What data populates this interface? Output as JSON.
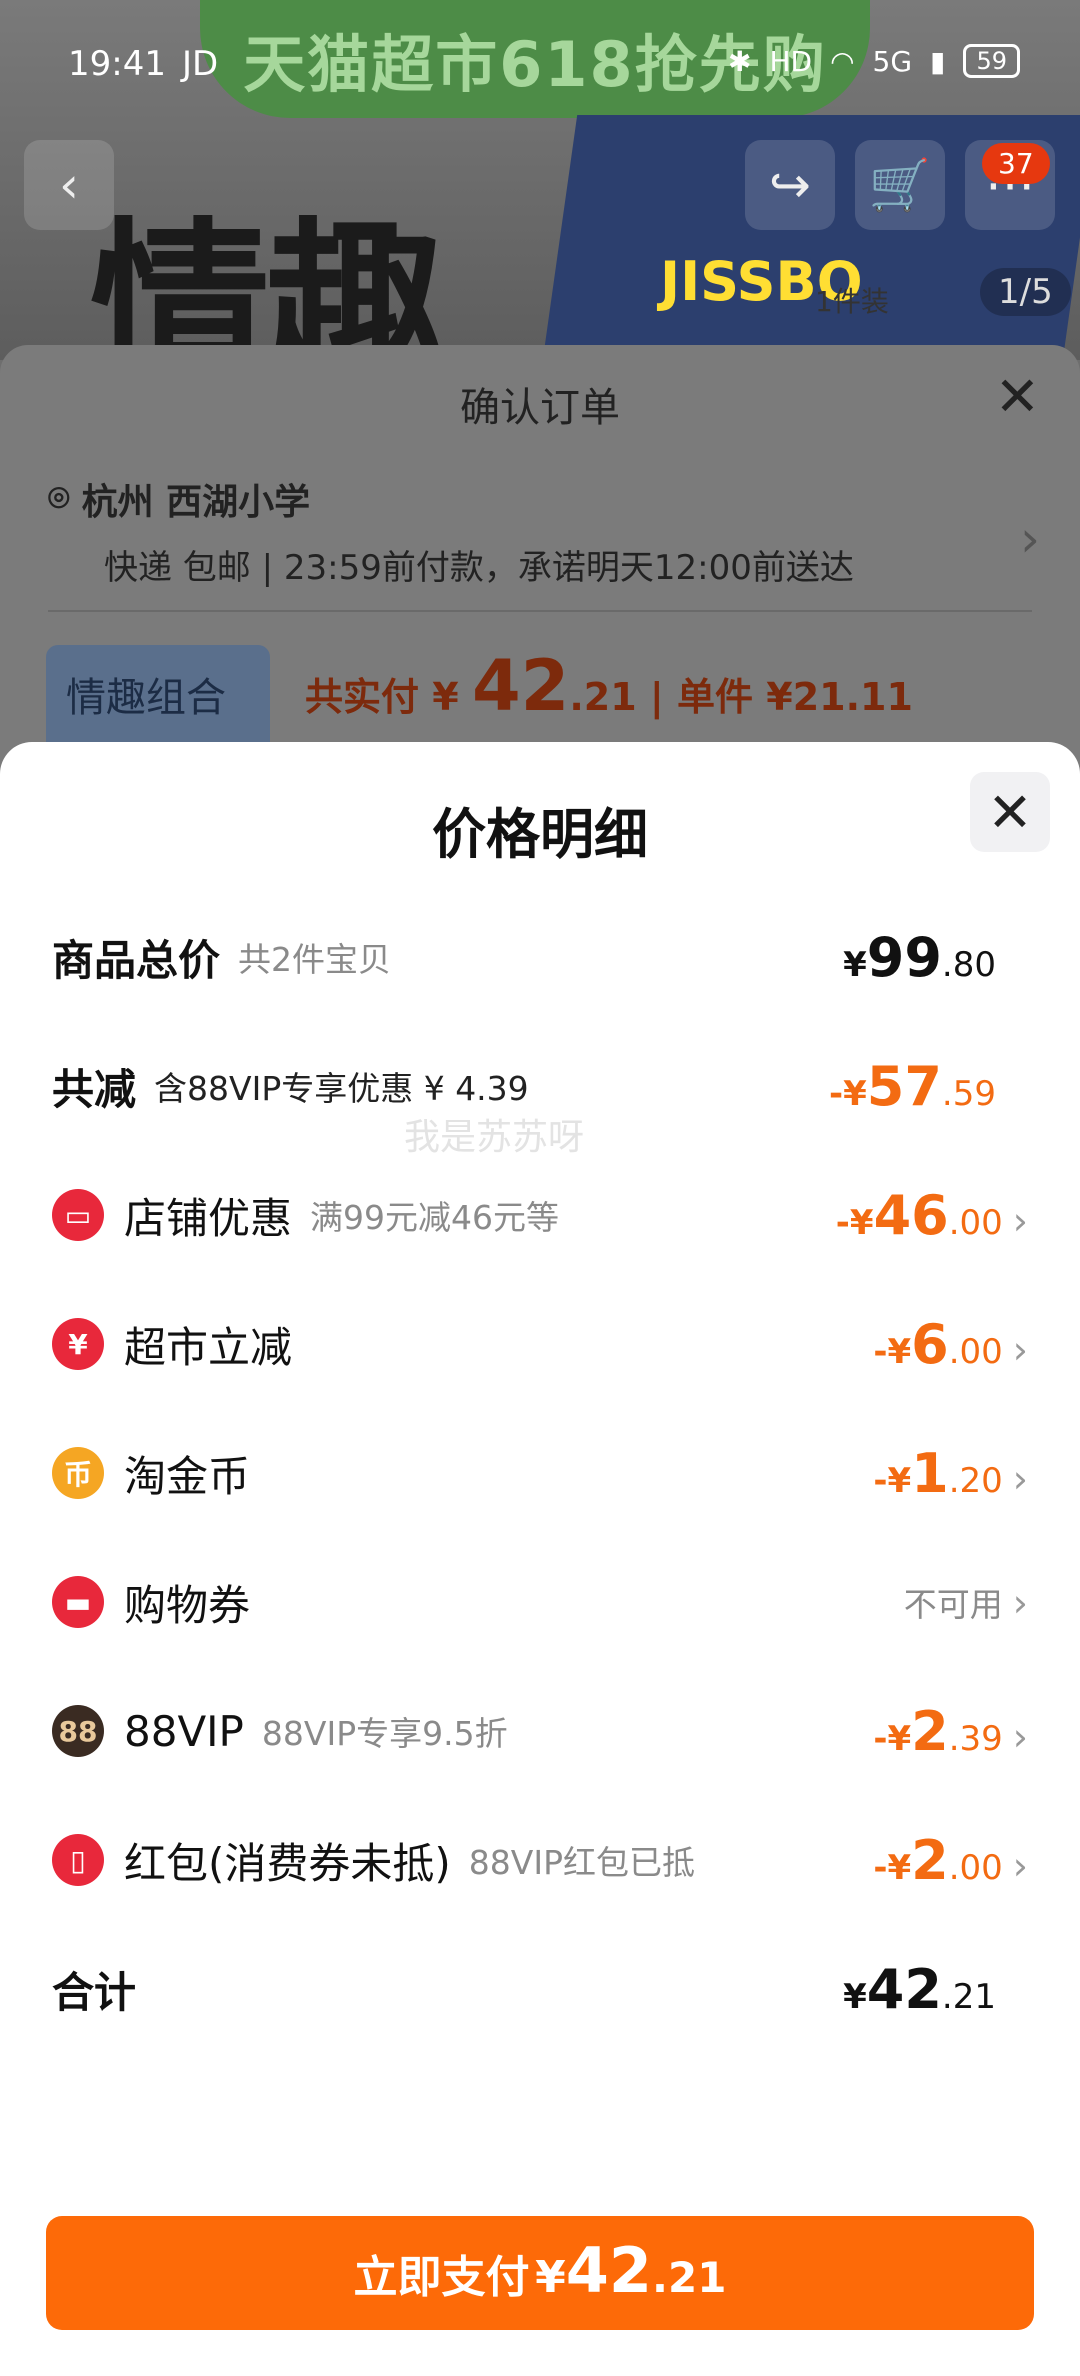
{
  "status_bar": {
    "time": "19:41",
    "carrier": "JD",
    "battery": "59",
    "network": "5G",
    "hd": "HD"
  },
  "background": {
    "promo_banner": "天猫超市618抢先购",
    "hero_text": "情趣",
    "brand_text": "JISSBO",
    "cart_badge": "37",
    "pager": "1/5",
    "pack_label": "1件装"
  },
  "confirm_order": {
    "title": "确认订单",
    "address": "杭州 西湖小学",
    "delivery": "快递 包邮 | 23:59前付款，承诺明天12:00前送达",
    "thumb_text": "情趣组合",
    "paid_label": "共实付",
    "paid_currency": "¥",
    "paid_int": "42",
    "paid_dec": ".21",
    "unit_price": "| 单件 ¥21.11"
  },
  "sheet": {
    "title": "价格明细",
    "rows": [
      {
        "label": "商品总价",
        "sub": "共2件宝贝",
        "cur": "¥",
        "int": "99",
        "dec": ".80"
      },
      {
        "label": "共减",
        "sub": "含88VIP专享优惠 ¥ 4.39",
        "cur": "-¥",
        "int": "57",
        "dec": ".59"
      },
      {
        "label": "店铺优惠",
        "sub": "满99元减46元等",
        "cur": "-¥",
        "int": "46",
        "dec": ".00",
        "icon": "store-icon"
      },
      {
        "label": "超市立减",
        "sub": "",
        "cur": "-¥",
        "int": "6",
        "dec": ".00",
        "icon": "discount-icon"
      },
      {
        "label": "淘金币",
        "sub": "",
        "cur": "-¥",
        "int": "1",
        "dec": ".20",
        "icon": "coin-icon"
      },
      {
        "label": "购物券",
        "sub": "",
        "value_text": "不可用",
        "icon": "coupon-icon"
      },
      {
        "label": "88VIP",
        "sub": "88VIP专享9.5折",
        "cur": "-¥",
        "int": "2",
        "dec": ".39",
        "icon": "vip88-icon"
      },
      {
        "label": "红包(消费券未抵)",
        "sub": "88VIP红包已抵",
        "cur": "-¥",
        "int": "2",
        "dec": ".00",
        "icon": "red-envelope-icon"
      },
      {
        "label": "合计",
        "sub": "",
        "cur": "¥",
        "int": "42",
        "dec": ".21"
      }
    ],
    "watermark": "我是苏苏呀",
    "pay_button": {
      "label": "立即支付",
      "cur": "¥",
      "int": "42",
      "dec": ".21"
    }
  },
  "colors": {
    "accent": "#fd6a08",
    "discount": "#f36b12",
    "icon_red": "#e8283b",
    "icon_gold": "#f5a623",
    "icon_dark": "#3a2b22"
  }
}
